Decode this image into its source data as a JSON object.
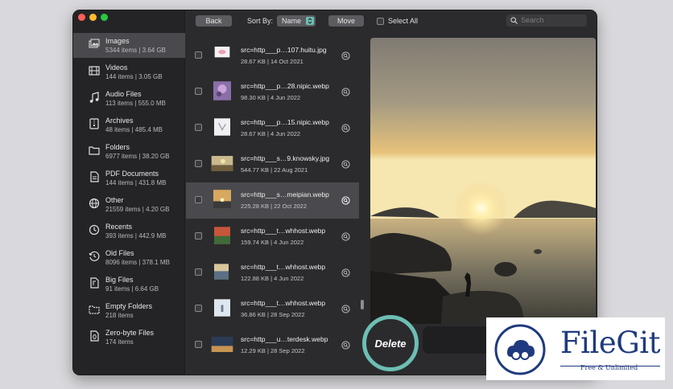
{
  "toolbar": {
    "back": "Back",
    "sort_by": "Sort By:",
    "sort_value": "Name",
    "move": "Move",
    "select_all": "Select All",
    "search_placeholder": "Search"
  },
  "sidebar": {
    "items": [
      {
        "title": "Images",
        "sub": "5344 items | 3.64 GB",
        "icon": "images-icon"
      },
      {
        "title": "Videos",
        "sub": "144 items | 3.05 GB",
        "icon": "film-icon"
      },
      {
        "title": "Audio Files",
        "sub": "113 items | 555.0 MB",
        "icon": "music-icon"
      },
      {
        "title": "Archives",
        "sub": "48 items | 485.4 MB",
        "icon": "archive-icon"
      },
      {
        "title": "Folders",
        "sub": "6977 items | 38.20 GB",
        "icon": "folder-icon"
      },
      {
        "title": "PDF Documents",
        "sub": "144 items | 431.8 MB",
        "icon": "pdf-icon"
      },
      {
        "title": "Other",
        "sub": "21559 items | 4.20 GB",
        "icon": "globe-icon"
      },
      {
        "title": "Recents",
        "sub": "393 items | 442.9 MB",
        "icon": "clock-icon"
      },
      {
        "title": "Old Files",
        "sub": "8096 items | 378.1 MB",
        "icon": "history-icon"
      },
      {
        "title": "Big Files",
        "sub": "91 items | 6.64 GB",
        "icon": "big-file-icon"
      },
      {
        "title": "Empty Folders",
        "sub": "218 items",
        "icon": "empty-folder-icon"
      },
      {
        "title": "Zero-byte Files",
        "sub": "174 items",
        "icon": "zero-file-icon"
      }
    ]
  },
  "files": [
    {
      "name": "src=http___p…107.huitu.jpg",
      "meta": "28.67 KB | 14 Oct 2021"
    },
    {
      "name": "src=http___p…28.nipic.webp",
      "meta": "98.30 KB | 4 Jun 2022"
    },
    {
      "name": "src=http___p…15.nipic.webp",
      "meta": "28.67 KB | 4 Jun 2022"
    },
    {
      "name": "src=http___s…9.knowsky.jpg",
      "meta": "544.77 KB | 22 Aug 2021"
    },
    {
      "name": "src=http___s…meipian.webp",
      "meta": "225.28 KB | 22 Oct 2022"
    },
    {
      "name": "src=http___t…whhost.webp",
      "meta": "159.74 KB | 4 Jun 2022"
    },
    {
      "name": "src=http___t…whhost.webp",
      "meta": "122.88 KB | 4 Jun 2022"
    },
    {
      "name": "src=http___t…whhost.webp",
      "meta": "36.86 KB | 28 Sep 2022"
    },
    {
      "name": "src=http___u…terdesk.webp",
      "meta": "12.29 KB | 28 Sep 2022"
    }
  ],
  "delete_label": "Delete",
  "logo": {
    "name": "FileGit",
    "tagline": "Free & Unlimited"
  },
  "colors": {
    "accent": "#6dbeb4",
    "brand": "#1f3a7e",
    "selected_row": "#4a4a4e"
  }
}
